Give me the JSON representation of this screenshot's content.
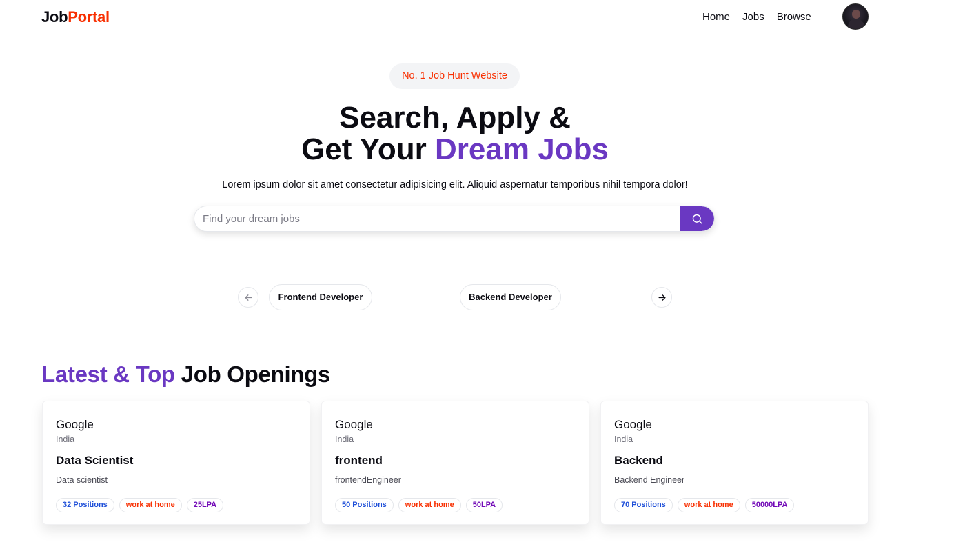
{
  "navbar": {
    "logo_part1": "Job",
    "logo_part2": "Portal",
    "links": [
      "Home",
      "Jobs",
      "Browse"
    ]
  },
  "hero": {
    "badge": "No. 1 Job Hunt Website",
    "title_line1": "Search, Apply &",
    "title_line2_plain": "Get Your ",
    "title_line2_accent": "Dream Jobs",
    "subtitle": "Lorem ipsum dolor sit amet consectetur adipisicing elit. Aliquid aspernatur temporibus nihil tempora dolor!",
    "search_placeholder": "Find your dream jobs"
  },
  "categories": [
    "Frontend Developer",
    "Backend Developer"
  ],
  "latest": {
    "title_accent": "Latest & Top",
    "title_plain": " Job Openings"
  },
  "jobs": [
    {
      "company": "Google",
      "location": "India",
      "title": "Data Scientist",
      "description": "Data scientist",
      "positions": "32 Positions",
      "job_type": "work at home",
      "salary": "25LPA"
    },
    {
      "company": "Google",
      "location": "India",
      "title": "frontend",
      "description": "frontendEngineer",
      "positions": "50 Positions",
      "job_type": "work at home",
      "salary": "50LPA"
    },
    {
      "company": "Google",
      "location": "India",
      "title": "Backend",
      "description": "Backend Engineer",
      "positions": "70 Positions",
      "job_type": "work at home",
      "salary": "50000LPA"
    }
  ],
  "colors": {
    "accent_purple": "#6a38c2",
    "accent_red": "#f83002",
    "positions_blue": "#1d4ed8",
    "salary_purple": "#7209b7"
  }
}
